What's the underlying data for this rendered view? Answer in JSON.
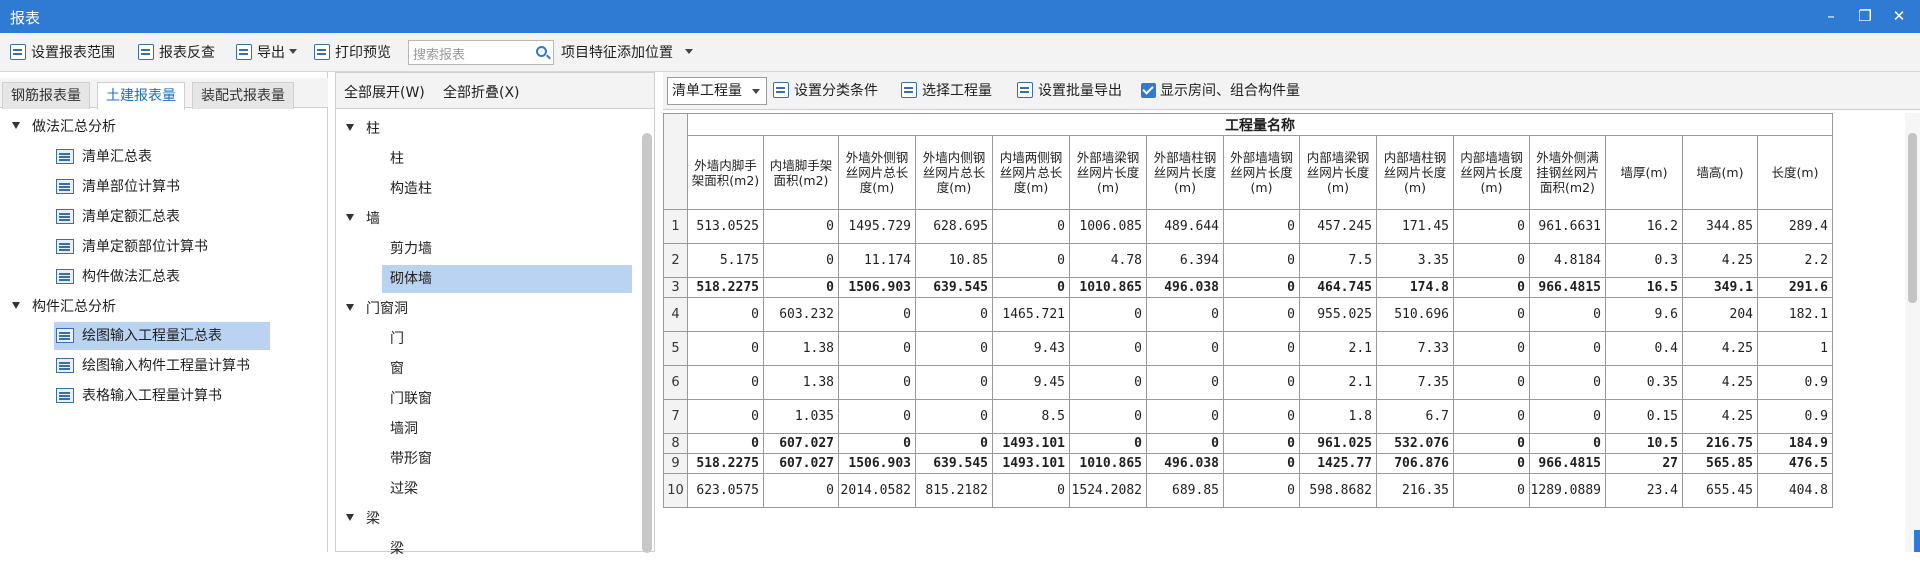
{
  "window": {
    "title": "报表",
    "minimize": "–",
    "restore": "❐",
    "close": "✕"
  },
  "toolbar": {
    "set_range": "设置报表范围",
    "reverse_check": "报表反查",
    "export": "导出",
    "print_preview": "打印预览",
    "search_placeholder": "搜索报表",
    "add_position": "项目特征添加位置"
  },
  "left_tabs": [
    "钢筋报表量",
    "土建报表量",
    "装配式报表量"
  ],
  "left_tree": {
    "group1": "做法汇总分析",
    "group1_items": [
      "清单汇总表",
      "清单部位计算书",
      "清单定额汇总表",
      "清单定额部位计算书",
      "构件做法汇总表"
    ],
    "group2": "构件汇总分析",
    "group2_items": [
      "绘图输入工程量汇总表",
      "绘图输入构件工程量计算书",
      "表格输入工程量计算书"
    ]
  },
  "middle": {
    "expand_all": "全部展开(W)",
    "collapse_all": "全部折叠(X)",
    "tree": [
      {
        "label": "柱",
        "level": 0
      },
      {
        "label": "柱",
        "level": 1
      },
      {
        "label": "构造柱",
        "level": 1
      },
      {
        "label": "墙",
        "level": 0
      },
      {
        "label": "剪力墙",
        "level": 1
      },
      {
        "label": "砌体墙",
        "level": 1,
        "selected": true
      },
      {
        "label": "门窗洞",
        "level": 0
      },
      {
        "label": "门",
        "level": 1
      },
      {
        "label": "窗",
        "level": 1
      },
      {
        "label": "门联窗",
        "level": 1
      },
      {
        "label": "墙洞",
        "level": 1
      },
      {
        "label": "带形窗",
        "level": 1
      },
      {
        "label": "过梁",
        "level": 1
      },
      {
        "label": "梁",
        "level": 0
      },
      {
        "label": "梁",
        "level": 1
      }
    ]
  },
  "right_toolbar": {
    "combo_value": "清单工程量",
    "set_category": "设置分类条件",
    "select_quantity": "选择工程量",
    "batch_export": "设置批量导出",
    "show_rooms": "显示房间、组合构件量"
  },
  "grid": {
    "title": "工程量名称",
    "columns": [
      "外墙内脚手架面积(m2)",
      "内墙脚手架面积(m2)",
      "外墙外侧钢丝网片总长度(m)",
      "外墙内侧钢丝网片总长度(m)",
      "内墙两侧钢丝网片总长度(m)",
      "外部墙梁钢丝网片长度(m)",
      "外部墙柱钢丝网片长度(m)",
      "外部墙墙钢丝网片长度(m)",
      "内部墙梁钢丝网片长度(m)",
      "内部墙柱钢丝网片长度(m)",
      "内部墙墙钢丝网片长度(m)",
      "外墙外侧满挂钢丝网片面积(m2)",
      "墙厚(m)",
      "墙高(m)",
      "长度(m)"
    ],
    "rows": [
      {
        "n": "1",
        "bold": false,
        "v": [
          "513.0525",
          "0",
          "1495.729",
          "628.695",
          "0",
          "1006.085",
          "489.644",
          "0",
          "457.245",
          "171.45",
          "0",
          "961.6631",
          "16.2",
          "344.85",
          "289.4"
        ]
      },
      {
        "n": "2",
        "bold": false,
        "v": [
          "5.175",
          "0",
          "11.174",
          "10.85",
          "0",
          "4.78",
          "6.394",
          "0",
          "7.5",
          "3.35",
          "0",
          "4.8184",
          "0.3",
          "4.25",
          "2.2"
        ]
      },
      {
        "n": "3",
        "bold": true,
        "v": [
          "518.2275",
          "0",
          "1506.903",
          "639.545",
          "0",
          "1010.865",
          "496.038",
          "0",
          "464.745",
          "174.8",
          "0",
          "966.4815",
          "16.5",
          "349.1",
          "291.6"
        ]
      },
      {
        "n": "4",
        "bold": false,
        "v": [
          "0",
          "603.232",
          "0",
          "0",
          "1465.721",
          "0",
          "0",
          "0",
          "955.025",
          "510.696",
          "0",
          "0",
          "9.6",
          "204",
          "182.1"
        ]
      },
      {
        "n": "5",
        "bold": false,
        "v": [
          "0",
          "1.38",
          "0",
          "0",
          "9.43",
          "0",
          "0",
          "0",
          "2.1",
          "7.33",
          "0",
          "0",
          "0.4",
          "4.25",
          "1"
        ]
      },
      {
        "n": "6",
        "bold": false,
        "v": [
          "0",
          "1.38",
          "0",
          "0",
          "9.45",
          "0",
          "0",
          "0",
          "2.1",
          "7.35",
          "0",
          "0",
          "0.35",
          "4.25",
          "0.9"
        ]
      },
      {
        "n": "7",
        "bold": false,
        "v": [
          "0",
          "1.035",
          "0",
          "0",
          "8.5",
          "0",
          "0",
          "0",
          "1.8",
          "6.7",
          "0",
          "0",
          "0.15",
          "4.25",
          "0.9"
        ]
      },
      {
        "n": "8",
        "bold": true,
        "v": [
          "0",
          "607.027",
          "0",
          "0",
          "1493.101",
          "0",
          "0",
          "0",
          "961.025",
          "532.076",
          "0",
          "0",
          "10.5",
          "216.75",
          "184.9"
        ]
      },
      {
        "n": "9",
        "bold": true,
        "v": [
          "518.2275",
          "607.027",
          "1506.903",
          "639.545",
          "1493.101",
          "1010.865",
          "496.038",
          "0",
          "1425.77",
          "706.876",
          "0",
          "966.4815",
          "27",
          "565.85",
          "476.5"
        ]
      },
      {
        "n": "10",
        "bold": false,
        "v": [
          "623.0575",
          "0",
          "2014.0582",
          "815.2182",
          "0",
          "1524.2082",
          "689.85",
          "0",
          "598.8682",
          "216.35",
          "0",
          "1289.0889",
          "23.4",
          "655.45",
          "404.8"
        ]
      }
    ]
  }
}
